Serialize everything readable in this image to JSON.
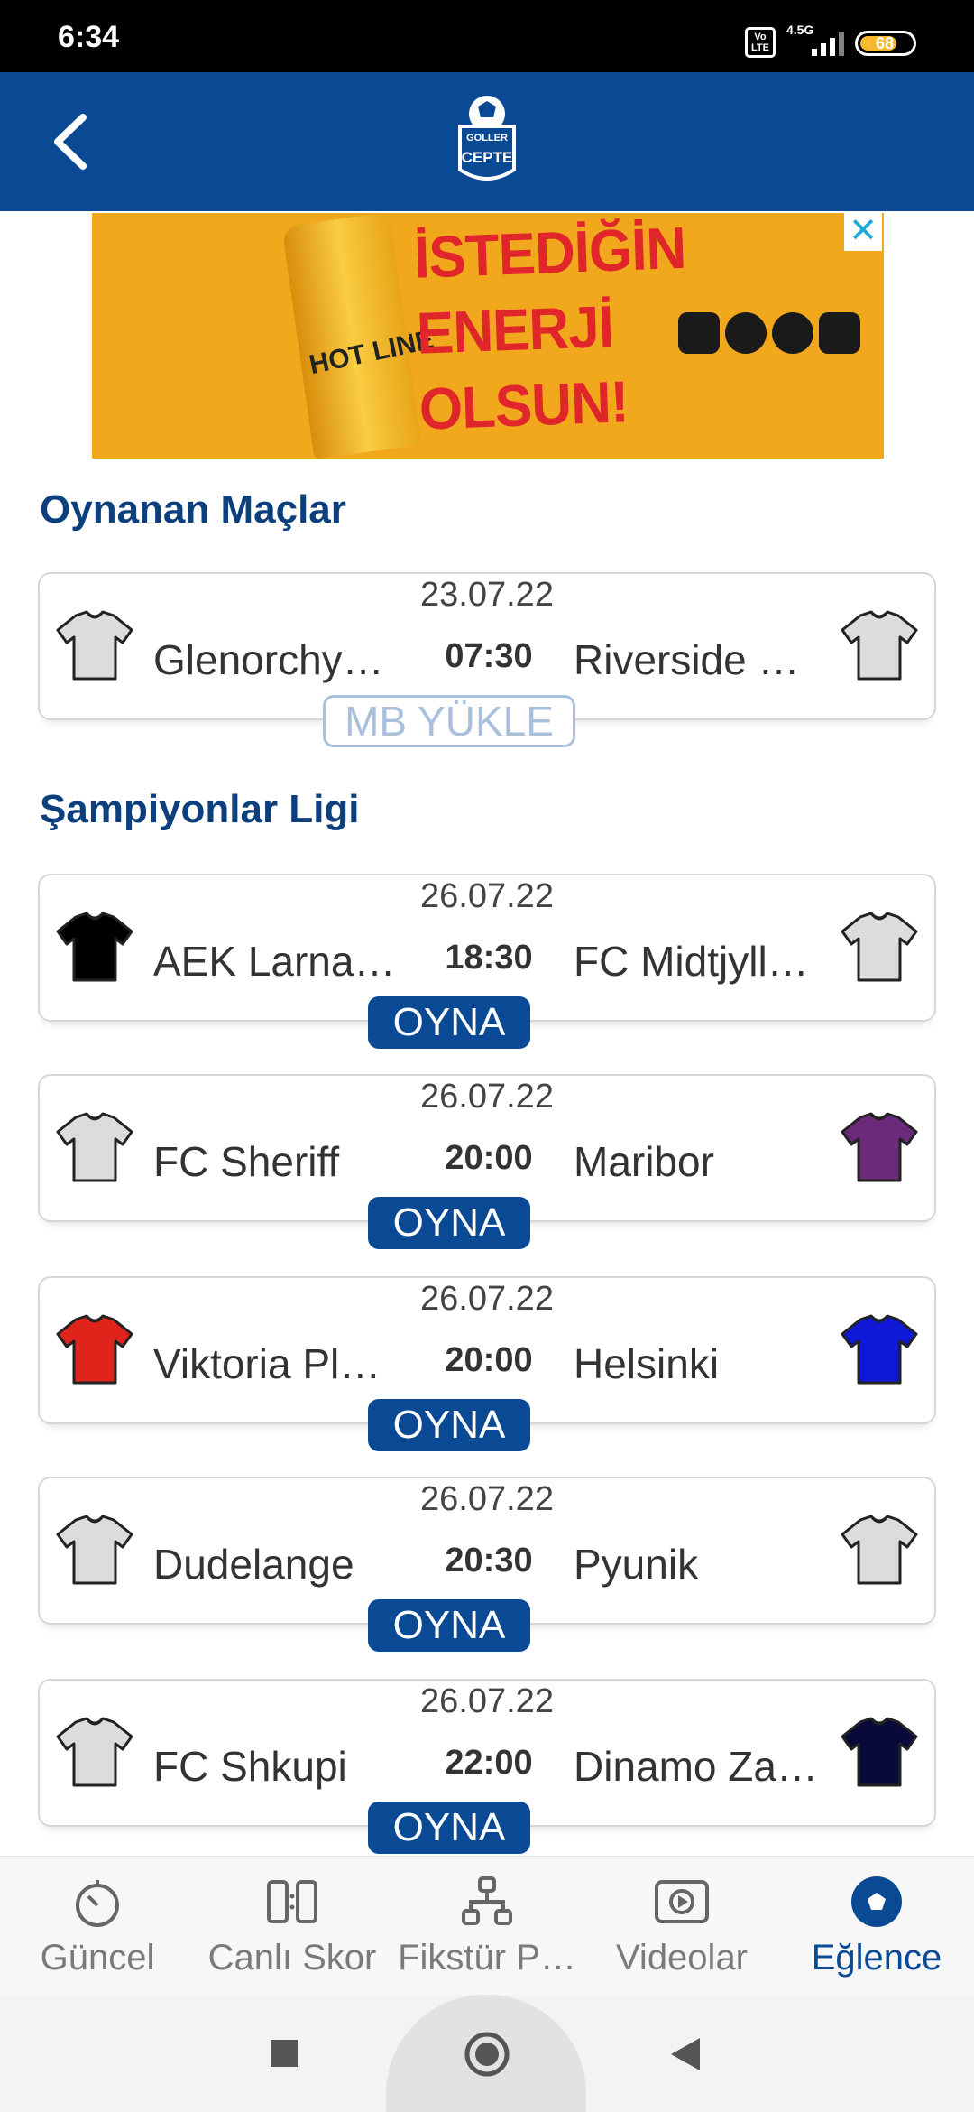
{
  "status_bar": {
    "time": "6:34",
    "volte": "Vo LTE",
    "network": "4.5G",
    "battery": "68"
  },
  "app_bar": {
    "logo_top": "GOLLER",
    "logo_bottom": "CEPTE"
  },
  "ad": {
    "headline": [
      "İSTEDİĞİN",
      "ENERJİ",
      "OLSUN!"
    ],
    "product": "HOT LINE",
    "close_label": "✕"
  },
  "sections": [
    {
      "title": "Oynanan Maçlar",
      "matches": [
        {
          "date": "23.07.22",
          "home": "Glenorchy…",
          "time": "07:30",
          "away": "Riverside O…",
          "action": "MB YÜKLE",
          "home_shirt": "#dcdcdc",
          "away_shirt": "#dcdcdc"
        }
      ]
    },
    {
      "title": "Şampiyonlar Ligi",
      "matches": [
        {
          "date": "26.07.22",
          "home": "AEK Larnaca",
          "time": "18:30",
          "away": "FC Midtjyll…",
          "action": "OYNA",
          "home_shirt": "#000000",
          "away_shirt": "#dcdcdc"
        },
        {
          "date": "26.07.22",
          "home": "FC Sheriff",
          "time": "20:00",
          "away": "Maribor",
          "action": "OYNA",
          "home_shirt": "#dcdcdc",
          "away_shirt": "#6b2a7a"
        },
        {
          "date": "26.07.22",
          "home": "Viktoria Plz…",
          "time": "20:00",
          "away": "Helsinki",
          "action": "OYNA",
          "home_shirt": "#e0241c",
          "away_shirt": "#1018d8"
        },
        {
          "date": "26.07.22",
          "home": "Dudelange",
          "time": "20:30",
          "away": "Pyunik",
          "action": "OYNA",
          "home_shirt": "#dcdcdc",
          "away_shirt": "#dcdcdc"
        },
        {
          "date": "26.07.22",
          "home": "FC Shkupi",
          "time": "22:00",
          "away": "Dinamo Za…",
          "action": "OYNA",
          "home_shirt": "#dcdcdc",
          "away_shirt": "#0a0a3a"
        }
      ]
    }
  ],
  "bottom_nav": [
    {
      "label": "Güncel",
      "icon": "stopwatch-icon",
      "active": false
    },
    {
      "label": "Canlı Skor",
      "icon": "scoreboard-icon",
      "active": false
    },
    {
      "label": "Fikstür P…",
      "icon": "bracket-icon",
      "active": false
    },
    {
      "label": "Videolar",
      "icon": "play-icon",
      "active": false
    },
    {
      "label": "Eğlence",
      "icon": "football-icon",
      "active": true
    }
  ],
  "colors": {
    "brand_blue": "#0a4a95",
    "section_title": "#0c3f7d",
    "ad_bg": "#f2a81d"
  }
}
